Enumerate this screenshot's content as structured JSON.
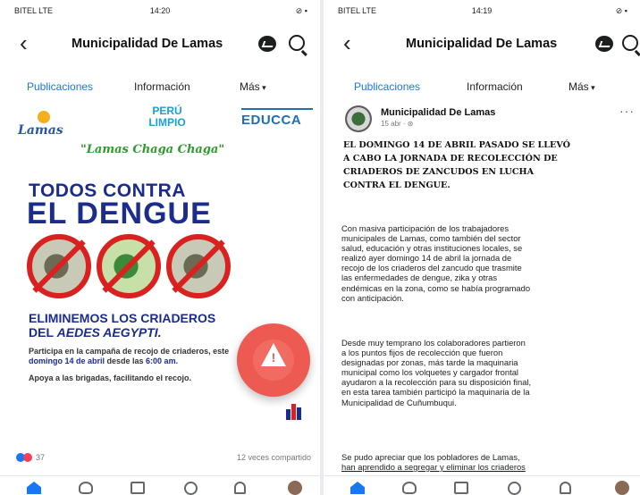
{
  "status_bar": {
    "left_carrier": "BITEL LTE",
    "left_time": "14:20",
    "right_carrier": "BITEL LTE",
    "right_time": "14:19",
    "icons": "⊘ ▪"
  },
  "header": {
    "page_title": "Municipalidad De Lamas",
    "back_icon": "‹"
  },
  "tabs": [
    {
      "label": "Publicaciones",
      "active": true
    },
    {
      "label": "Información",
      "active": false
    },
    {
      "label": "Más",
      "active": false
    }
  ],
  "poster": {
    "logo_lamas": "Lamas",
    "logo_peru": "PERÚ\nLIMPIO",
    "logo_educca": "EDUCCA",
    "slogan": "\"Lamas Chaga Chaga\"",
    "headline_line1": "TODOS CONTRA",
    "headline_line2": "EL DENGUE",
    "sub_line1": "ELIMINEMOS LOS CRIADEROS",
    "sub_line2_prefix": "DEL ",
    "sub_line2_species": "AEDES AEGYPTI.",
    "body_1_a": "Participa en la campaña de recojo de criaderos, este ",
    "body_1_b": "domingo 14 de abril",
    "body_1_c": " desde las ",
    "body_1_d": "6:00 am.",
    "body_2": "Apoya a las brigadas, facilitando el recojo.",
    "alert_mark": "!"
  },
  "left_reactions": {
    "count": "37",
    "shares": "12 veces compartido"
  },
  "post": {
    "author": "Municipalidad De Lamas",
    "timestamp": "15 abr · ⊛",
    "more": "···",
    "heading": "EL DOMINGO 14 DE ABRIL PASADO SE LLEVÓ\nA CABO LA JORNADA DE RECOLECCIÓN DE\nCRIADEROS DE ZANCUDOS EN LUCHA\nCONTRA EL DENGUE.",
    "para_1": "Con masiva participación de los trabajadores\nmunicipales de Lamas, como también del sector\nsalud, educación y otras instituciones locales, se\nrealizó ayer domingo 14 de abril la jornada de\nrecojo de los criaderos del zancudo que trasmite\nlas enfermedades de dengue, zika y otras\nendémicas en la zona, como se había programado\ncon anticipación.",
    "para_2": "Desde muy temprano los colaboradores partieron\na los puntos fijos de recolección que fueron\ndesignadas por zonas, más tarde la maquinaria\nmunicipal como los volquetes y cargador frontal\nayudaron a la recolección para su disposición final,\nen esta tarea también participó la maquinaria de la\nMunicipalidad de Cuñumbuqui.",
    "para_3": "Se pudo apreciar que los pobladores de Lamas,",
    "para_3_line2": "han aprendido a segregar y eliminar los criaderos"
  },
  "colors": {
    "facebook_blue": "#1877f2",
    "poster_navy": "#1b2c8c",
    "alert_red": "#ec5a52"
  },
  "icons": [
    "back-icon",
    "messenger-icon",
    "search-icon",
    "home-icon",
    "friends-icon",
    "marketplace-icon",
    "watch-icon",
    "notifications-icon",
    "profile-avatar"
  ]
}
